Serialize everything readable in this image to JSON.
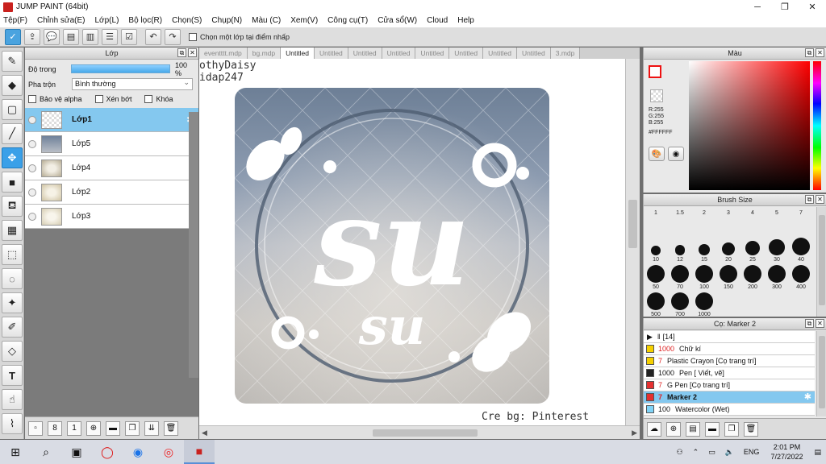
{
  "window": {
    "title": "JUMP PAINT (64bit)",
    "controls": [
      "─",
      "❐",
      "✕"
    ]
  },
  "menu": [
    "Tệp(F)",
    "Chỉnh sửa(E)",
    "Lớp(L)",
    "Bộ lọc(R)",
    "Chọn(S)",
    "Chụp(N)",
    "Màu (C)",
    "Xem(V)",
    "Công cụ(T)",
    "Cửa sổ(W)",
    "Cloud",
    "Help"
  ],
  "toolbar": {
    "pick_layer_label": "Chọn một lớp tại điểm nhấp",
    "pick_layer_checked": false
  },
  "layer_panel": {
    "title": "Lớp",
    "opacity_label": "Độ trong",
    "opacity_value": "100 %",
    "opacity": 1.0,
    "blend_label": "Pha trộn",
    "blend_value": "Bình thường",
    "protect_alpha": "Bảo vệ alpha",
    "clipping": "Xén bớt",
    "lock": "Khóa",
    "layers": [
      {
        "name": "Lớp1",
        "selected": true
      },
      {
        "name": "Lớp5",
        "selected": false
      },
      {
        "name": "Lớp4",
        "selected": false
      },
      {
        "name": "Lớp2",
        "selected": false
      },
      {
        "name": "Lớp3",
        "selected": false
      }
    ]
  },
  "document_tabs": [
    {
      "label": "eventttt.mdp",
      "active": false
    },
    {
      "label": "bg.mdp",
      "active": false
    },
    {
      "label": "Untitled",
      "active": true
    },
    {
      "label": "Untitled",
      "active": false
    },
    {
      "label": "Untitled",
      "active": false
    },
    {
      "label": "Untitled",
      "active": false
    },
    {
      "label": "Untitled",
      "active": false
    },
    {
      "label": "Untitled",
      "active": false
    },
    {
      "label": "Untitled",
      "active": false
    },
    {
      "label": "Untitled",
      "active": false
    },
    {
      "label": "3.mdp",
      "active": false
    }
  ],
  "canvas": {
    "watermark_top_1": "othyDaisy",
    "watermark_top_2": "idap247",
    "credit": "Cre bg: Pinterest",
    "art_text_big": "su",
    "art_text_small": "su"
  },
  "color_panel": {
    "title": "Màu",
    "r": "R:255",
    "g": "G:255",
    "b": "B:255",
    "hex": "#FFFFFF",
    "fg_color": "#ffffff"
  },
  "brush_panel": {
    "title": "Brush Size",
    "sizes": [
      "1",
      "1.5",
      "2",
      "3",
      "4",
      "5",
      "7",
      "10",
      "12",
      "15",
      "20",
      "25",
      "30",
      "40",
      "50",
      "70",
      "100",
      "150",
      "200",
      "300",
      "400",
      "500",
      "700",
      "1000"
    ]
  },
  "marker_panel": {
    "title": "Cọ: Marker 2",
    "group": "[14]",
    "items": [
      {
        "count": "1000",
        "name": "Chữ kí",
        "color": "#f5d000",
        "selected": false,
        "count_red": true
      },
      {
        "count": "7",
        "name": "Plastic Crayon [Cọ trang trí]",
        "color": "#f5d000",
        "selected": false,
        "count_red": true
      },
      {
        "count": "1000",
        "name": "Pen [ Viết, vẽ]",
        "color": "#222222",
        "selected": false,
        "count_red": false
      },
      {
        "count": "7",
        "name": "G Pen [Cọ trang trí]",
        "color": "#e53030",
        "selected": false,
        "count_red": true
      },
      {
        "count": "7",
        "name": "Marker 2",
        "color": "#e53030",
        "selected": true,
        "count_red": true
      },
      {
        "count": "100",
        "name": "Watercolor (Wet)",
        "color": "#7fd3f7",
        "selected": false,
        "count_red": false
      }
    ]
  },
  "taskbar": {
    "lang": "ENG",
    "time": "2:01 PM",
    "date": "7/27/2022"
  }
}
